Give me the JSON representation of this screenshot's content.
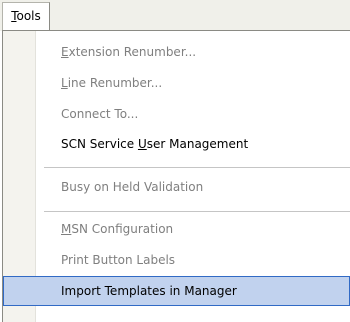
{
  "menu": {
    "title": {
      "label": "Tools",
      "accel_index": 0
    }
  },
  "dropdown": {
    "items": [
      {
        "label": "Extension Renumber...",
        "accel_index": 0,
        "enabled": false
      },
      {
        "label": "Line Renumber...",
        "accel_index": 0,
        "enabled": false
      },
      {
        "label": "Connect To...",
        "accel_index": -1,
        "enabled": false
      },
      {
        "label": "SCN Service User Management",
        "accel_index": 12,
        "enabled": true
      },
      {
        "label": "Busy on Held Validation",
        "accel_index": -1,
        "enabled": false
      },
      {
        "label": "MSN Configuration",
        "accel_index": 0,
        "enabled": false
      },
      {
        "label": "Print Button Labels",
        "accel_index": -1,
        "enabled": false
      },
      {
        "label": "Import Templates in Manager",
        "accel_index": -1,
        "enabled": true,
        "highlighted": true
      }
    ]
  },
  "colors": {
    "highlight_fill": "#c1d2ee",
    "highlight_border": "#316ac5",
    "disabled_text": "#7f7f7f"
  }
}
